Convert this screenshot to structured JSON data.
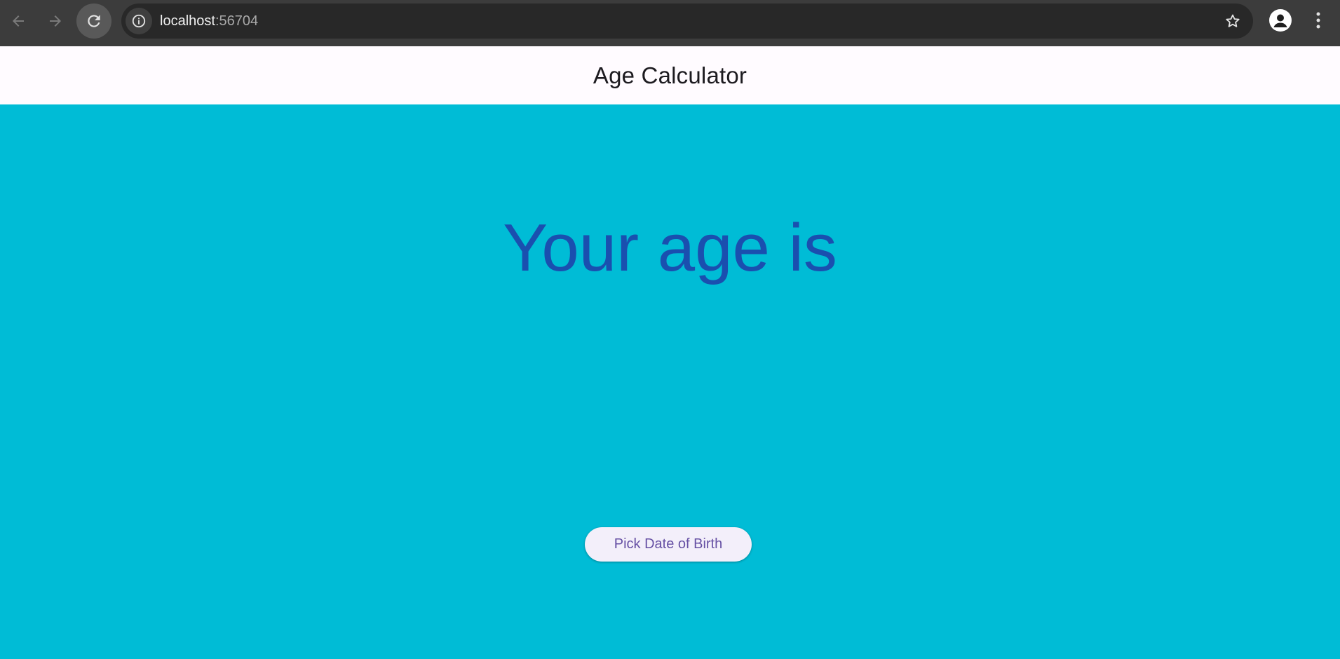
{
  "browser": {
    "url_host": "localhost",
    "url_port": ":56704",
    "icons": {
      "back": "arrow-left-icon",
      "forward": "arrow-right-icon",
      "reload": "reload-icon",
      "site_info": "info-icon",
      "bookmark": "star-icon",
      "profile": "person-icon",
      "menu": "more-vertical-icon"
    }
  },
  "app_bar": {
    "title": "Age Calculator"
  },
  "main": {
    "heading": "Your age is",
    "age_value": "",
    "pick_button_label": "Pick Date of Birth"
  },
  "colors": {
    "background": "#00bcd6",
    "heading": "#1a4faf",
    "app_bar": "#fffbff",
    "button_bg": "#f3effa",
    "button_text": "#6650a4"
  }
}
